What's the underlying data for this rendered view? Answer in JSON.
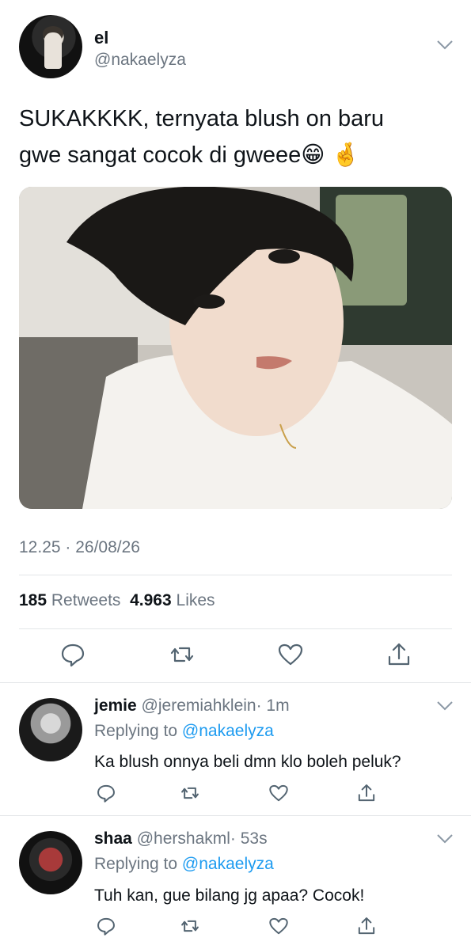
{
  "tweet": {
    "author_name": "el",
    "author_handle": "@nakaelyza",
    "text_line1": "SUKAKKKK, ternyata blush on baru",
    "text_line2": "gwe sangat cocok di gweee",
    "emoji1": "😁",
    "emoji2": "🤞",
    "timestamp": "12.25 · 26/08/26",
    "retweets_count": "185",
    "retweets_label": "Retweets",
    "likes_count": "4.963",
    "likes_label": "Likes"
  },
  "replies": [
    {
      "name": "jemie",
      "handle": "@jeremiahklein",
      "time": "· 1m",
      "replying_label": "Replying to",
      "replying_to": "@nakaelyza",
      "text": "Ka blush onnya beli dmn klo boleh peluk?"
    },
    {
      "name": "shaa",
      "handle": "@hershakml",
      "time": "· 53s",
      "replying_label": "Replying to",
      "replying_to": "@nakaelyza",
      "text": "Tuh kan, gue bilang jg apaa? Cocok!"
    }
  ],
  "icons": {
    "reply": "reply-icon",
    "retweet": "retweet-icon",
    "like": "heart-icon",
    "share": "share-icon",
    "more": "chevron-down-icon"
  },
  "colors": {
    "text": "#0f1419",
    "secondary": "#6b7580",
    "link": "#1d9bf0",
    "divider": "#e3e6e8",
    "icon": "#536471"
  }
}
